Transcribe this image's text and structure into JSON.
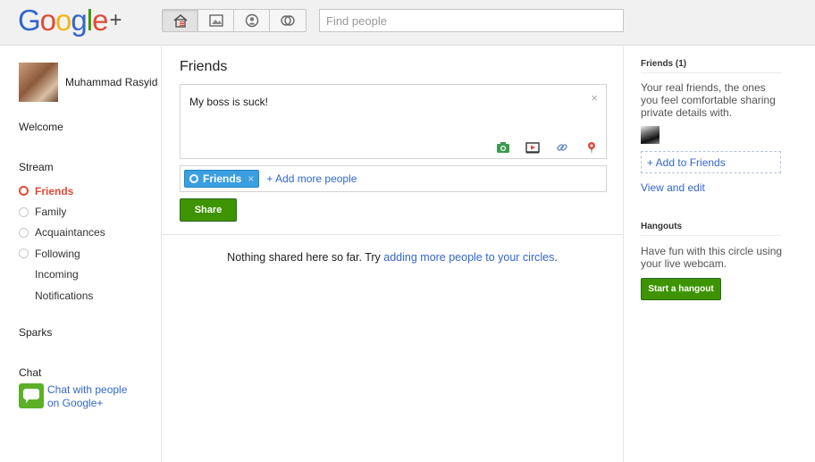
{
  "header": {
    "logo_text": "Google",
    "logo_plus": "+",
    "search_placeholder": "Find people",
    "nav_icons": [
      "home-icon",
      "photos-icon",
      "profile-icon",
      "circles-icon"
    ]
  },
  "profile": {
    "name": "Muhammad Rasyid"
  },
  "sidebar": {
    "welcome": "Welcome",
    "stream": "Stream",
    "stream_items": [
      {
        "label": "Friends",
        "active": true
      },
      {
        "label": "Family"
      },
      {
        "label": "Acquaintances"
      },
      {
        "label": "Following"
      },
      {
        "label": "Incoming"
      },
      {
        "label": "Notifications"
      }
    ],
    "sparks": "Sparks",
    "chat": "Chat",
    "chat_link": "Chat with people on Google+"
  },
  "main": {
    "title": "Friends",
    "share_text": "My boss is suck!",
    "close_glyph": "×",
    "chip_label": "Friends",
    "chip_remove": "×",
    "add_more": "+ Add more people",
    "share_button": "Share",
    "empty_text": "Nothing shared here so far. Try ",
    "empty_link": "adding more people to your circles",
    "empty_end": "."
  },
  "right": {
    "friends_title": "Friends (1)",
    "friends_desc": "Your real friends, the ones you feel comfortable sharing private details with.",
    "add_to_friends": "+ Add to Friends",
    "view_edit": "View and edit",
    "hangouts_title": "Hangouts",
    "hangouts_desc": "Have fun with this circle using your live webcam.",
    "hangout_button": "Start a hangout"
  },
  "colors": {
    "accent_red": "#dd4b39",
    "link_blue": "#3366cc",
    "button_green": "#3d9400",
    "chip_blue": "#3a9ee0"
  }
}
